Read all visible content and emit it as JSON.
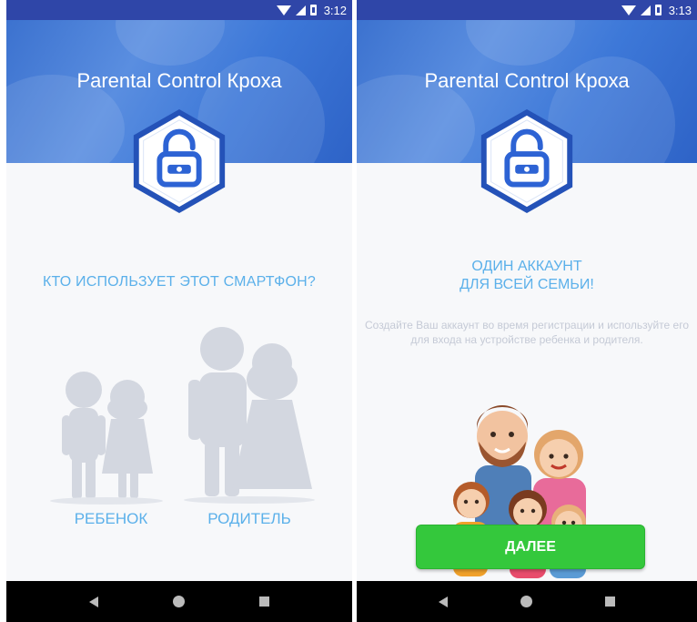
{
  "left_screen": {
    "status_time": "3:12",
    "app_title": "Parental Control Кроха",
    "question": "КТО ИСПОЛЬЗУЕТ ЭТОТ СМАРТФОН?",
    "child_label": "РЕБЕНОК",
    "parent_label": "РОДИТЕЛЬ"
  },
  "right_screen": {
    "status_time": "3:13",
    "app_title": "Parental Control Кроха",
    "promo_title_line1": "ОДИН АККАУНТ",
    "promo_title_line2": "ДЛЯ ВСЕЙ СЕМЬИ!",
    "promo_text": "Создайте Ваш аккаунт во время регистрации и используйте его для входа на устройстве ребенка и родителя.",
    "next_button_label": "ДАЛЕЕ"
  },
  "colors": {
    "status_bar": "#2f46a8",
    "header_blue": "#3d78d8",
    "accent_text": "#5bb0ea",
    "button_green": "#34c83c",
    "silhouette": "#d3d7e0"
  },
  "icons": [
    "wifi-icon",
    "signal-icon",
    "battery-icon",
    "lock-icon",
    "back-icon",
    "home-icon",
    "recents-icon"
  ]
}
